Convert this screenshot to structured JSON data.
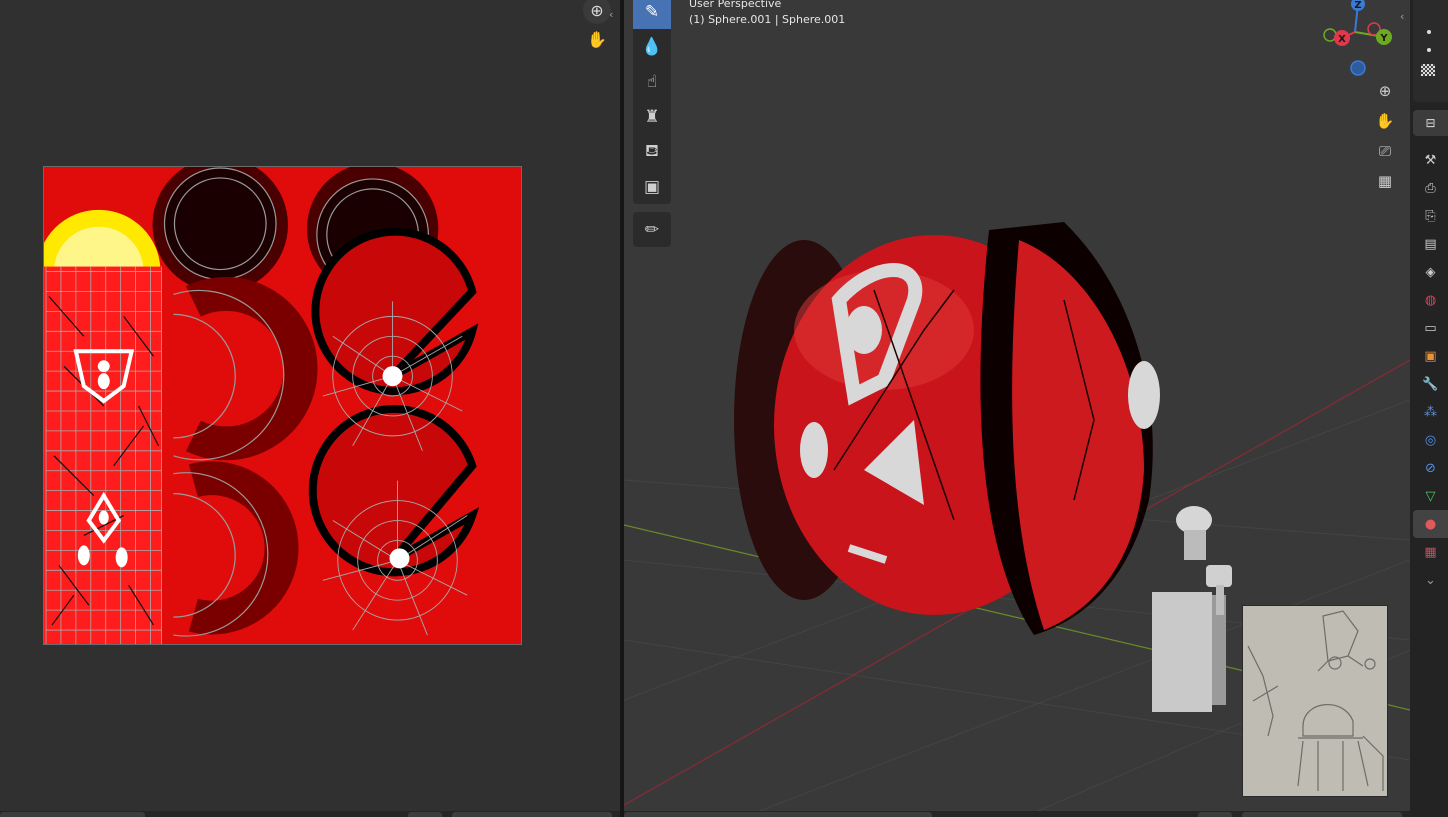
{
  "viewport": {
    "view_name": "User Perspective",
    "object_info": "(1) Sphere.001 | Sphere.001"
  },
  "toolbar": {
    "tools": [
      {
        "name": "draw",
        "icon": "brush-icon",
        "glyph": "✎",
        "active": true
      },
      {
        "name": "blur",
        "icon": "drop-icon",
        "glyph": "💧",
        "active": false
      },
      {
        "name": "smear",
        "icon": "smear-icon",
        "glyph": "☝",
        "active": false
      },
      {
        "name": "clone",
        "icon": "stamp-icon",
        "glyph": "♜",
        "active": false
      },
      {
        "name": "fill",
        "icon": "bucket-icon",
        "glyph": "⛾",
        "active": false
      },
      {
        "name": "mask",
        "icon": "mask-icon",
        "glyph": "▣",
        "active": false
      }
    ],
    "annotate": {
      "name": "annotate",
      "icon": "annotate-pen-icon",
      "glyph": "✏"
    }
  },
  "navigation": {
    "zoom_icon": "zoom-icon",
    "pan_icon": "hand-icon",
    "camera_icon": "camera-icon",
    "ortho_icon": "grid-view-icon"
  },
  "gizmo": {
    "x_label": "X",
    "y_label": "Y",
    "z_label": "Z",
    "colors": {
      "x": "#e0394c",
      "y": "#6eaa1f",
      "z": "#3a7bd5"
    }
  },
  "properties_tabs": [
    {
      "name": "tool",
      "icon": "tool-icon",
      "glyph": "⚒",
      "color": "#cccccc"
    },
    {
      "name": "render",
      "icon": "render-camera-icon",
      "glyph": "⎙",
      "color": "#cccccc"
    },
    {
      "name": "output",
      "icon": "printer-icon",
      "glyph": "⎘",
      "color": "#cccccc"
    },
    {
      "name": "view-layer",
      "icon": "image-stack-icon",
      "glyph": "▤",
      "color": "#cccccc"
    },
    {
      "name": "scene",
      "icon": "scene-icon",
      "glyph": "◈",
      "color": "#cccccc"
    },
    {
      "name": "world",
      "icon": "world-icon",
      "glyph": "◍",
      "color": "#d04a5a"
    },
    {
      "name": "collection",
      "icon": "collection-box-icon",
      "glyph": "▭",
      "color": "#cccccc"
    },
    {
      "name": "object",
      "icon": "object-square-icon",
      "glyph": "▣",
      "color": "#e8923a"
    },
    {
      "name": "modifiers",
      "icon": "wrench-icon",
      "glyph": "🔧",
      "color": "#5a8fe0"
    },
    {
      "name": "particles",
      "icon": "particles-icon",
      "glyph": "⁂",
      "color": "#5a8fe0"
    },
    {
      "name": "physics",
      "icon": "physics-icon",
      "glyph": "◎",
      "color": "#5a8fe0"
    },
    {
      "name": "constraints",
      "icon": "constraint-icon",
      "glyph": "⊘",
      "color": "#5a8fe0"
    },
    {
      "name": "data",
      "icon": "mesh-data-icon",
      "glyph": "▽",
      "color": "#4ec46a"
    },
    {
      "name": "material",
      "icon": "material-sphere-icon",
      "glyph": "●",
      "color": "#e05a5a",
      "active": true
    },
    {
      "name": "texture",
      "icon": "checker-texture-icon",
      "glyph": "▦",
      "color": "#d04a5a"
    },
    {
      "name": "more",
      "icon": "chevron-down-icon",
      "glyph": "⌄",
      "color": "#999999"
    }
  ]
}
